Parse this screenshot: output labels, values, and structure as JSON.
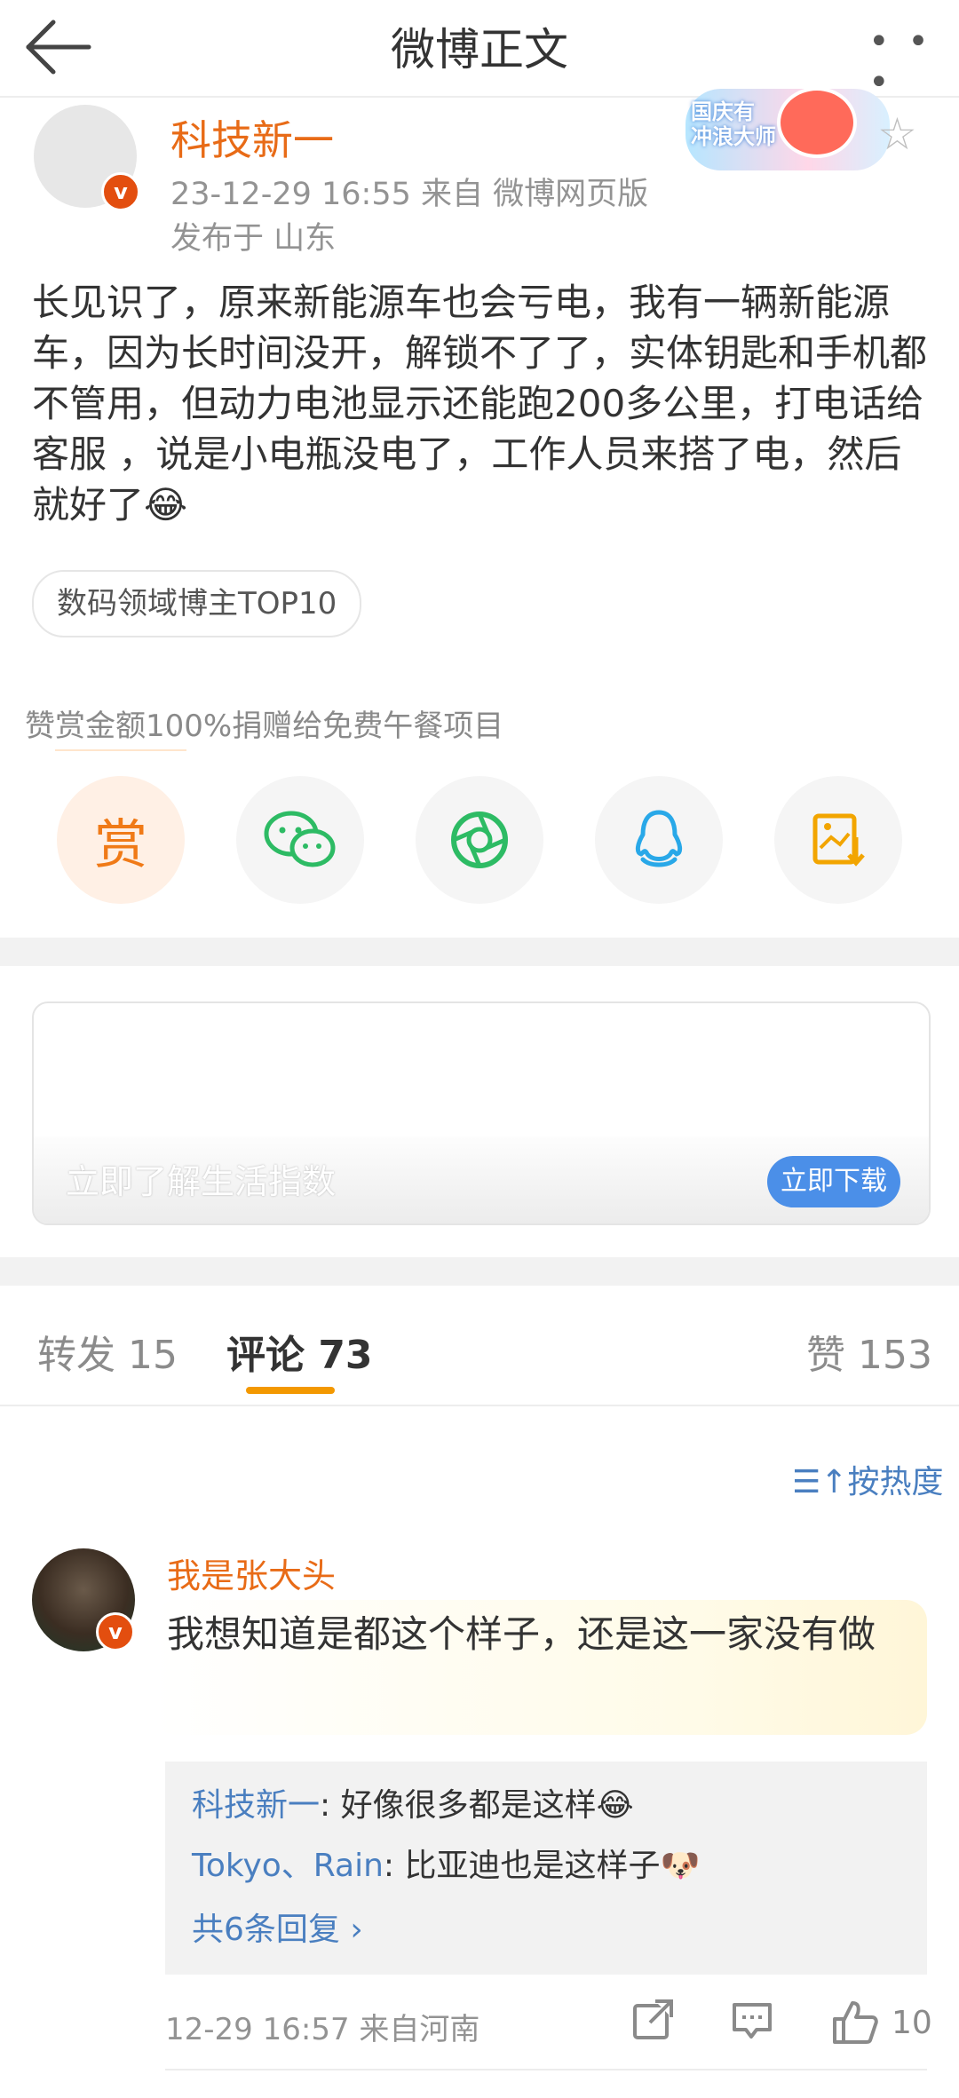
{
  "header": {
    "title": "微博正文",
    "more_label": "• • •"
  },
  "post": {
    "author": "科技新一",
    "meta": "23-12-29 16:55   来自 微博网页版",
    "location": "发布于 山东",
    "badge_text": "国庆有\n冲浪大师",
    "body": "长见识了，原来新能源车也会亏电，我有一辆新能源车，因为长时间没开，解锁不了了，实体钥匙和手机都不管用，但动力电池显示还能跑200多公里，打电话给客服 ，说是小电瓶没电了，工作人员来搭了电，然后就好了😂",
    "tag": "数码领域博主TOP10",
    "reward_note": "赞赏金额100%捐赠给免费午餐项目",
    "reward_label": "赏"
  },
  "ad": {
    "text": "立即了解生活指数",
    "button": "立即下载"
  },
  "tabs": {
    "repost": "转发 15",
    "comment": "评论 73",
    "like": "赞 153"
  },
  "sort_label": "按热度",
  "comment": {
    "user": "我是张大头",
    "text": "我想知道是都这个样子，还是这一家没有做",
    "replies": [
      {
        "name": "科技新一",
        "text": ": 好像很多都是这样😂"
      },
      {
        "name": "Tokyo、Rain",
        "text": ": 比亚迪也是这样子🐶"
      }
    ],
    "more_replies": "共6条回复 ›",
    "meta": "12-29 16:57  来自河南",
    "like_count": "10"
  },
  "colors": {
    "accent": "#e86b17",
    "link": "#4a7fc0",
    "tab_indicator": "#f39800"
  }
}
